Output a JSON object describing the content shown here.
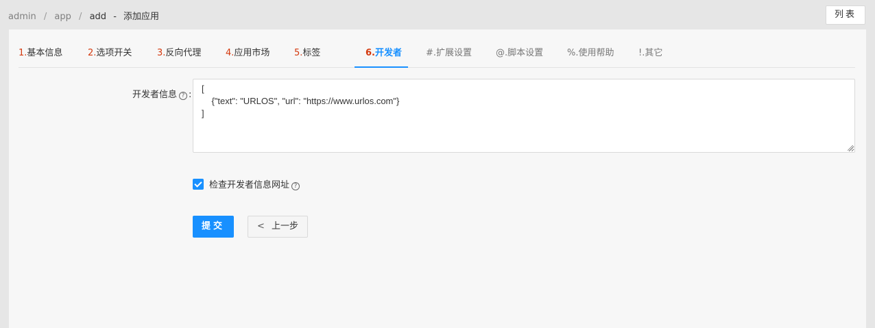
{
  "breadcrumb": {
    "items": [
      "admin",
      "app",
      "add"
    ],
    "separator": "/",
    "dash": "-",
    "page_title": "添加应用"
  },
  "header": {
    "list_button": "列表"
  },
  "tabs": [
    {
      "num": "1.",
      "label": "基本信息"
    },
    {
      "num": "2.",
      "label": "选项开关"
    },
    {
      "num": "3.",
      "label": "反向代理"
    },
    {
      "num": "4.",
      "label": "应用市场"
    },
    {
      "num": "5.",
      "label": "标签"
    },
    {
      "num": "6.",
      "label": "开发者",
      "active": true
    },
    {
      "num": "",
      "label": "#.扩展设置"
    },
    {
      "num": "",
      "label": "@.脚本设置"
    },
    {
      "num": "",
      "label": "%.使用帮助"
    },
    {
      "num": "",
      "label": "!.其它"
    }
  ],
  "form": {
    "developer_info_label": "开发者信息",
    "label_colon": ":",
    "help_glyph": "?",
    "developer_info_value": "[\n    {\"text\": \"URLOS\", \"url\": \"https://www.urlos.com\"}\n]",
    "check_url_label": "检查开发者信息网址",
    "check_url_checked": true
  },
  "actions": {
    "submit": "提交",
    "prev_chevron": "<",
    "prev": "上一步"
  },
  "colors": {
    "accent": "#1890ff",
    "tab_number": "#d4380d"
  }
}
